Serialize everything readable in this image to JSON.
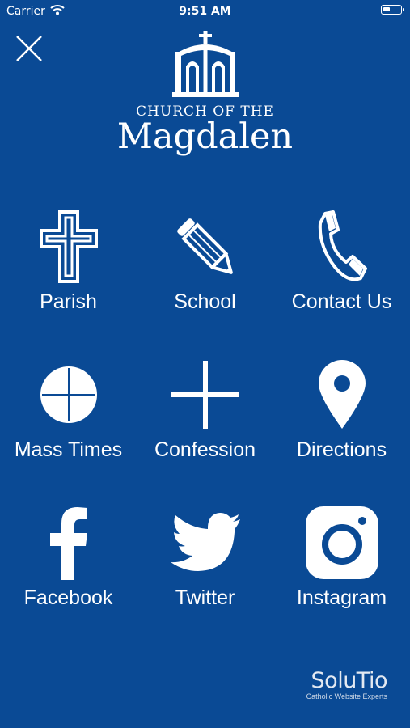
{
  "status_bar": {
    "carrier": "Carrier",
    "time": "9:51 AM",
    "battery_level": 0.4
  },
  "header": {
    "close_icon": "close-icon",
    "logo_icon": "church-building-icon",
    "logo_line1": "CHURCH OF THE",
    "logo_line2": "Magdalen"
  },
  "menu": {
    "items": [
      {
        "label": "Parish",
        "icon": "cross-icon"
      },
      {
        "label": "School",
        "icon": "pencil-icon"
      },
      {
        "label": "Contact Us",
        "icon": "phone-icon"
      },
      {
        "label": "Mass Times",
        "icon": "host-icon"
      },
      {
        "label": "Confession",
        "icon": "plus-icon"
      },
      {
        "label": "Directions",
        "icon": "map-pin-icon"
      },
      {
        "label": "Facebook",
        "icon": "facebook-icon"
      },
      {
        "label": "Twitter",
        "icon": "twitter-icon"
      },
      {
        "label": "Instagram",
        "icon": "instagram-icon"
      }
    ]
  },
  "footer": {
    "brand": "SoluTio",
    "tagline": "Catholic Website Experts"
  },
  "colors": {
    "background": "#0a4a95",
    "foreground": "#ffffff"
  }
}
